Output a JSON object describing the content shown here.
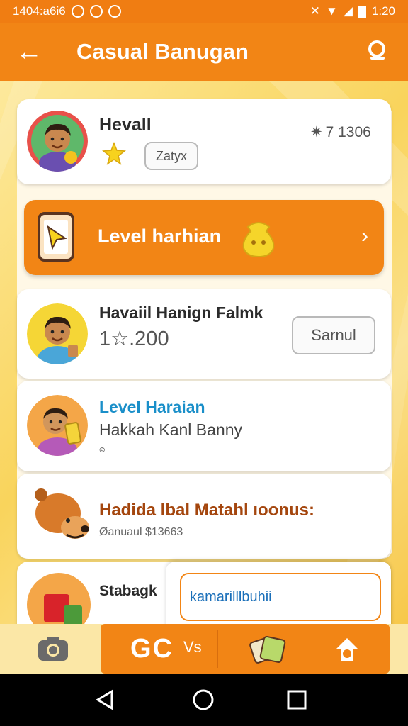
{
  "status": {
    "left_text": "1404:a6i6",
    "time": "1:20"
  },
  "app_bar": {
    "title": "Casual Banugan"
  },
  "profile": {
    "name": "Hevall",
    "tag_label": "Zatyx",
    "score": "7 1306"
  },
  "banner": {
    "label": "Level harhian"
  },
  "items": [
    {
      "title": "Havaiil Hanign Falmk",
      "amount": "1☆.200",
      "button_label": "Sarnul"
    },
    {
      "title": "Level Haraian",
      "subtitle": "Hakkah Kanl Banny",
      "footnote": "๏"
    },
    {
      "title": "Hadida lbal Matahl ıoonus:",
      "subtitle": "Øanuaul $13663"
    },
    {
      "title": "Stabagk"
    }
  ],
  "popup": {
    "input_value": "kamarilllbuhii"
  },
  "bottom_tabs": [
    {
      "icon": "camera-icon"
    },
    {
      "label": "GC",
      "sublabel": "Vs",
      "icon": "gc-icon"
    },
    {
      "icon": "cards-icon"
    },
    {
      "icon": "upload-icon"
    }
  ],
  "colors": {
    "primary": "#f28515",
    "status_bar": "#f07d12",
    "background": "#f6cf55",
    "link_blue": "#1a8fc9",
    "brown_title": "#a4460e"
  }
}
